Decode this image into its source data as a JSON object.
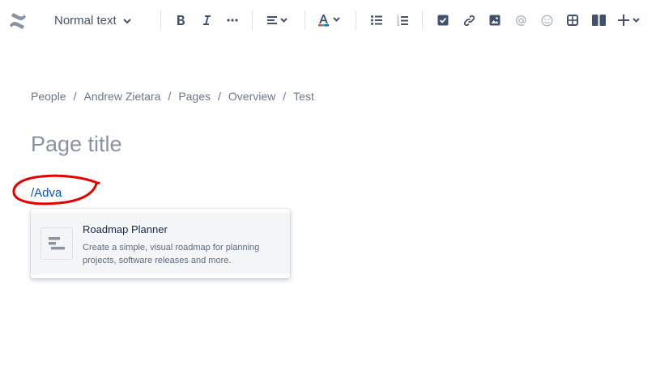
{
  "toolbar": {
    "text_style_label": "Normal text",
    "icons": [
      "bold-icon",
      "italic-icon",
      "more-formatting-icon",
      "align-icon",
      "text-color-icon",
      "bullet-list-icon",
      "numbered-list-icon",
      "action-item-icon",
      "link-icon",
      "image-icon",
      "mention-icon",
      "emoji-icon",
      "table-icon",
      "layout-icon",
      "insert-plus-icon"
    ]
  },
  "breadcrumb": {
    "items": [
      "People",
      "Andrew Zietara",
      "Pages",
      "Overview",
      "Test"
    ],
    "separator": "/"
  },
  "editor": {
    "title_placeholder": "Page title",
    "slash_command": "/Adva"
  },
  "dropdown": {
    "items": [
      {
        "title": "Roadmap Planner",
        "description": "Create a simple, visual roadmap for planning projects, software releases and more."
      }
    ]
  },
  "colors": {
    "accent": "#0052cc",
    "annotation": "#e60000",
    "icon": "#42526e"
  }
}
